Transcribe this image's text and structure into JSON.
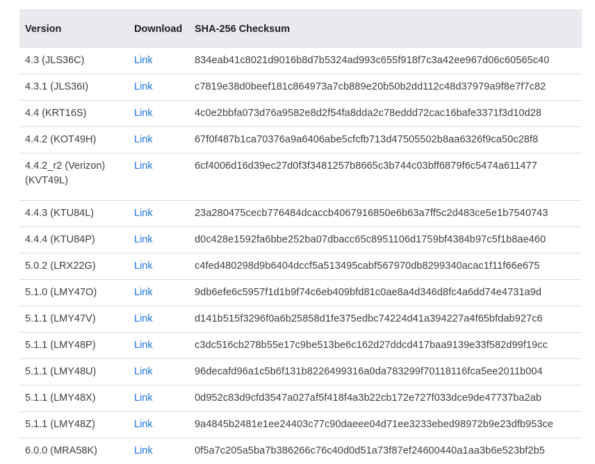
{
  "table": {
    "headers": [
      "Version",
      "Download",
      "SHA-256 Checksum"
    ],
    "link_label": "Link",
    "rows": [
      {
        "version": "4.3 (JLS36C)",
        "checksum": "834eab41c8021d9016b8d7b5324ad993c655f918f7c3a42ee967d06c60565c40"
      },
      {
        "version": "4.3.1 (JLS36I)",
        "checksum": "c7819e38d0beef181c864973a7cb889e20b50b2dd112c48d37979a9f8e7f7c82"
      },
      {
        "version": "4.4 (KRT16S)",
        "checksum": "4c0e2bbfa073d76a9582e8d2f54fa8dda2c78eddd72cac16bafe3371f3d10d28"
      },
      {
        "version": "4.4.2 (KOT49H)",
        "checksum": "67f0f487b1ca70376a9a6406abe5cfcfb713d47505502b8aa6326f9ca50c28f8"
      },
      {
        "version": "4.4.2_r2 (Verizon) (KVT49L)",
        "checksum": "6cf4006d16d39ec27d0f3f3481257b8665c3b744c03bff6879f6c5474a611477"
      },
      {
        "version": "4.4.3 (KTU84L)",
        "checksum": "23a280475cecb776484dcaccb4067916850e6b63a7ff5c2d483ce5e1b7540743"
      },
      {
        "version": "4.4.4 (KTU84P)",
        "checksum": "d0c428e1592fa6bbe252ba07dbacc65c8951106d1759bf4384b97c5f1b8ae460"
      },
      {
        "version": "5.0.2 (LRX22G)",
        "checksum": "c4fed480298d9b6404dccf5a513495cabf567970db8299340acac1f11f66e675"
      },
      {
        "version": "5.1.0 (LMY47O)",
        "checksum": "9db6efe6c5957f1d1b9f74c6eb409bfd81c0ae8a4d346d8fc4a6dd74e4731a9d"
      },
      {
        "version": "5.1.1 (LMY47V)",
        "checksum": "d141b515f3296f0a6b25858d1fe375edbc74224d41a394227a4f65bfdab927c6"
      },
      {
        "version": "5.1.1 (LMY48P)",
        "checksum": "c3dc516cb278b55e17c9be513be6c162d27ddcd417baa9139e33f582d99f19cc"
      },
      {
        "version": "5.1.1 (LMY48U)",
        "checksum": "96decafd96a1c5b6f131b8226499316a0da783299f70118116fca5ee2011b004"
      },
      {
        "version": "5.1.1 (LMY48X)",
        "checksum": "0d952c83d9cfd3547a027af5f418f4a3b22cb172e727f033dce9de47737ba2ab"
      },
      {
        "version": "5.1.1 (LMY48Z)",
        "checksum": "9a4845b2481e1ee24403c77c90daeee04d71ee3233ebed98972b9e23dfb953ce"
      },
      {
        "version": "6.0.0 (MRA58K)",
        "checksum": "0f5a7c205a5ba7b386266c76c40d0d51a73f87ef24600440a1aa3b6e523bf2b5"
      }
    ]
  },
  "colors": {
    "link": "#1a73e8",
    "header_bg": "#e8eaed",
    "border": "#dadce0",
    "text": "#3c4043"
  }
}
